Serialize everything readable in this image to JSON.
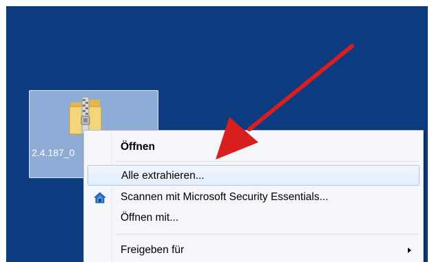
{
  "desktop": {
    "background_color": "#0c3c7f",
    "file": {
      "label": "2.4.187_0",
      "icon": "zip-folder-icon"
    }
  },
  "context_menu": {
    "items": [
      {
        "label": "Öffnen",
        "bold": true,
        "icon": ""
      },
      {
        "label": "Alle extrahieren...",
        "bold": false,
        "highlighted": true,
        "icon": ""
      },
      {
        "label": "Scannen mit Microsoft Security Essentials...",
        "bold": false,
        "icon": "security-essentials-icon"
      },
      {
        "label": "Öffnen mit...",
        "bold": false,
        "icon": ""
      },
      {
        "label": "Freigeben für",
        "bold": false,
        "icon": "",
        "submenu": true
      }
    ]
  },
  "annotation": {
    "arrow_color": "#d81e1e",
    "arrow_target": "Alle extrahieren..."
  }
}
